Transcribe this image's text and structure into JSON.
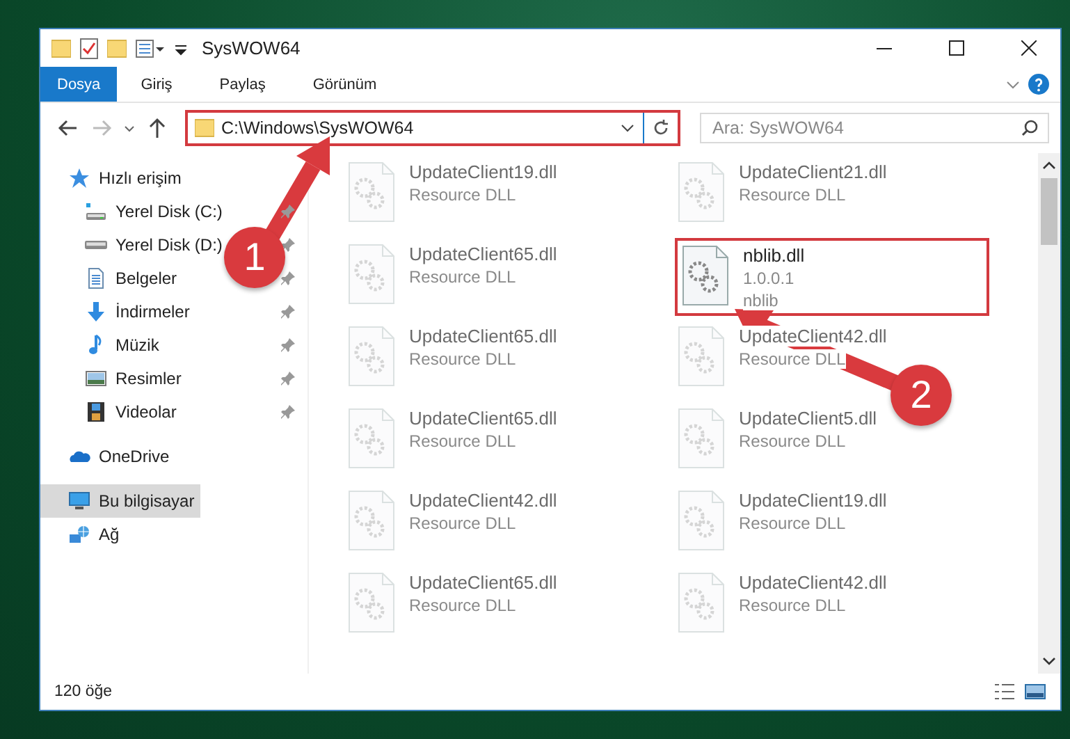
{
  "window": {
    "title": "SysWOW64"
  },
  "ribbon_tabs": [
    {
      "label": "Dosya",
      "selected": true
    },
    {
      "label": "Giriş",
      "selected": false
    },
    {
      "label": "Paylaş",
      "selected": false
    },
    {
      "label": "Görünüm",
      "selected": false
    }
  ],
  "address": {
    "path": "C:\\Windows\\SysWOW64",
    "boxed": true
  },
  "search": {
    "placeholder": "Ara: SysWOW64"
  },
  "sidebar": {
    "items": [
      {
        "label": "Hızlı erişim",
        "kind": "star",
        "selected": false,
        "children": [
          {
            "label": "Yerel Disk (C:)",
            "kind": "system-drive",
            "pinned": true,
            "selected": false
          },
          {
            "label": "Yerel Disk (D:)",
            "kind": "drive",
            "pinned": true,
            "selected": false
          },
          {
            "label": "Belgeler",
            "kind": "documents",
            "pinned": true,
            "selected": false
          },
          {
            "label": "İndirmeler",
            "kind": "download",
            "pinned": true,
            "selected": false
          },
          {
            "label": "Müzik",
            "kind": "music",
            "pinned": true,
            "selected": false
          },
          {
            "label": "Resimler",
            "kind": "pictures",
            "pinned": true,
            "selected": false
          },
          {
            "label": "Videolar",
            "kind": "videos",
            "pinned": true,
            "selected": false
          }
        ]
      },
      {
        "label": "OneDrive",
        "kind": "cloud",
        "selected": false,
        "gap": true
      },
      {
        "label": "Bu bilgisayar",
        "kind": "computer",
        "selected": true,
        "gap": true
      },
      {
        "label": "Ağ",
        "kind": "network",
        "selected": false
      }
    ]
  },
  "files": [
    {
      "name": "UpdateClient19.dll",
      "details": [
        "Resource DLL"
      ],
      "blurred": true,
      "boxed": false
    },
    {
      "name": "UpdateClient21.dll",
      "details": [
        "Resource DLL"
      ],
      "blurred": true,
      "boxed": false
    },
    {
      "name": "UpdateClient65.dll",
      "details": [
        "Resource DLL"
      ],
      "blurred": true,
      "boxed": false
    },
    {
      "name": "nblib.dll",
      "details": [
        "1.0.0.1",
        "nblib"
      ],
      "blurred": false,
      "boxed": true
    },
    {
      "name": "UpdateClient65.dll",
      "details": [
        "Resource DLL"
      ],
      "blurred": true,
      "boxed": false
    },
    {
      "name": "UpdateClient42.dll",
      "details": [
        "Resource DLL"
      ],
      "blurred": true,
      "boxed": false
    },
    {
      "name": "UpdateClient65.dll",
      "details": [
        "Resource DLL"
      ],
      "blurred": true,
      "boxed": false
    },
    {
      "name": "UpdateClient5.dll",
      "details": [
        "Resource DLL"
      ],
      "blurred": true,
      "boxed": false
    },
    {
      "name": "UpdateClient42.dll",
      "details": [
        "Resource DLL"
      ],
      "blurred": true,
      "boxed": false
    },
    {
      "name": "UpdateClient19.dll",
      "details": [
        "Resource DLL"
      ],
      "blurred": true,
      "boxed": false
    },
    {
      "name": "UpdateClient65.dll",
      "details": [
        "Resource DLL"
      ],
      "blurred": true,
      "boxed": false
    },
    {
      "name": "UpdateClient42.dll",
      "details": [
        "Resource DLL"
      ],
      "blurred": true,
      "boxed": false
    }
  ],
  "status_bar": {
    "count": "120 öğe"
  },
  "annotations": [
    {
      "label": "1"
    },
    {
      "label": "2"
    }
  ]
}
